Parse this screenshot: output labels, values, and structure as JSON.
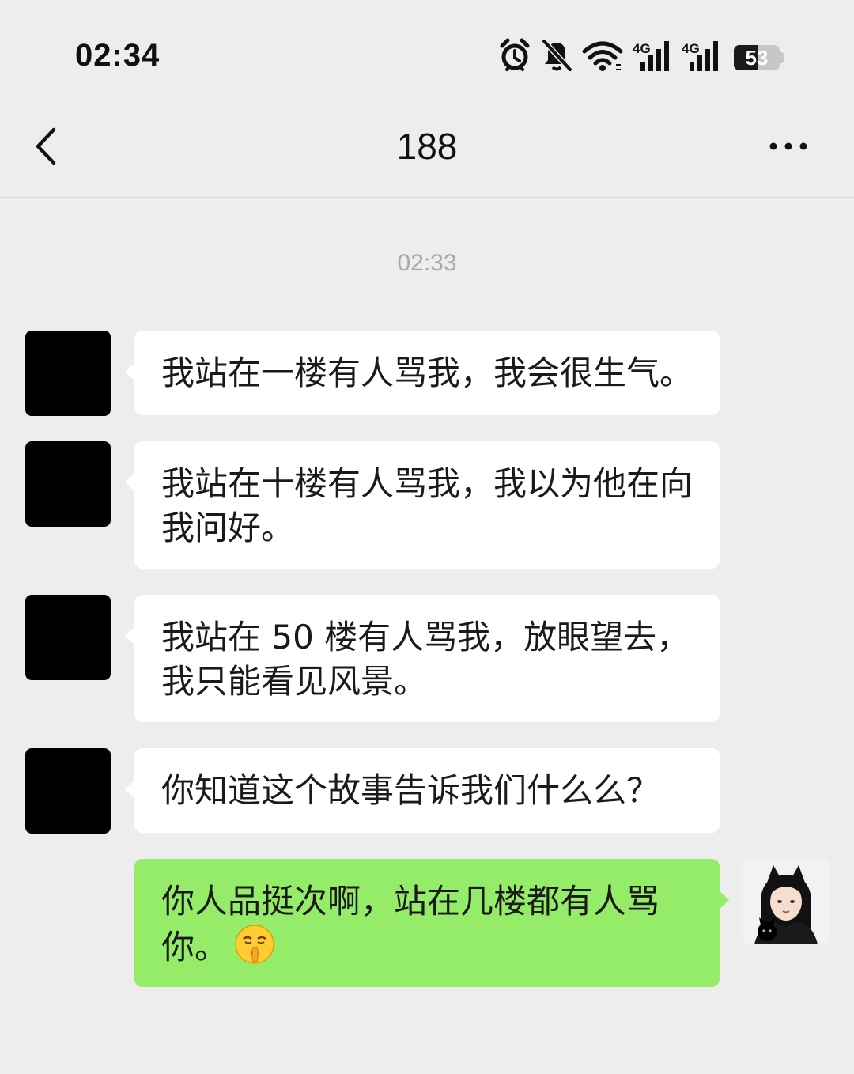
{
  "status_bar": {
    "time": "02:34",
    "network_1": "4G",
    "network_2": "4G",
    "battery": "53",
    "battery_level": 0.53,
    "icons": [
      "alarm-icon",
      "mute-bell-icon",
      "wifi-icon",
      "signal-icon",
      "signal-icon",
      "battery-icon"
    ]
  },
  "nav": {
    "title": "188",
    "icons": [
      "back-icon",
      "more-icon"
    ]
  },
  "chat": {
    "timestamp": "02:33",
    "messages": [
      {
        "side": "incoming",
        "text": "我站在一楼有人骂我，我会很生气。"
      },
      {
        "side": "incoming",
        "text": "我站在十楼有人骂我，我以为他在向我问好。"
      },
      {
        "side": "incoming",
        "text": "我站在 50 楼有人骂我，放眼望去，我只能看见风景。"
      },
      {
        "side": "incoming",
        "text": "你知道这个故事告诉我们什么么？"
      },
      {
        "side": "outgoing",
        "text": "你人品挺次啊，站在几楼都有人骂你。",
        "emoji": "shushing-face-emoji"
      }
    ]
  },
  "colors": {
    "background": "#ededed",
    "incoming_bubble": "#ffffff",
    "outgoing_bubble": "#95ec69",
    "timestamp": "#a8a8a8"
  }
}
